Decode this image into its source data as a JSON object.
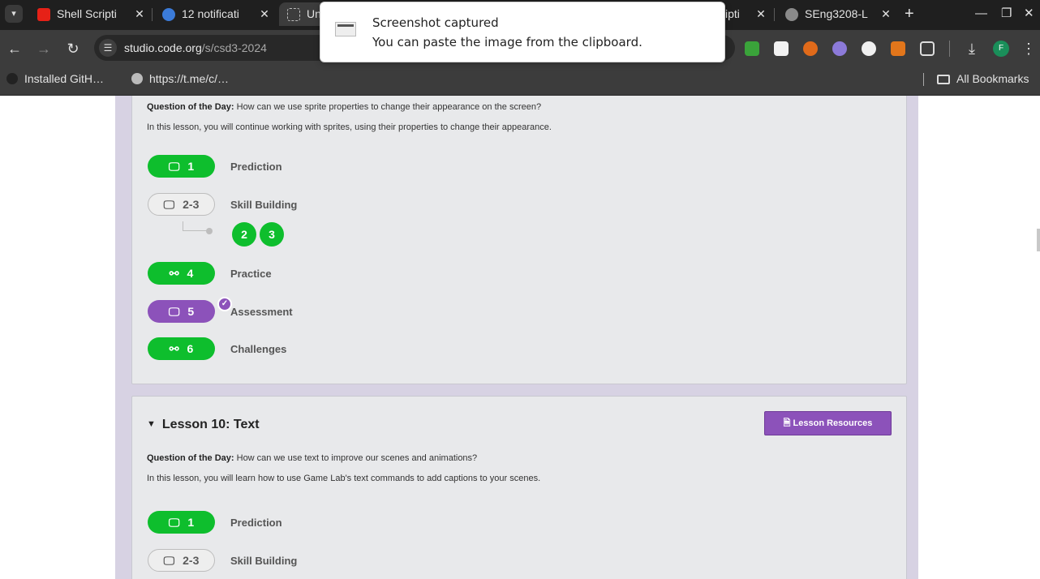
{
  "browser": {
    "tabs": [
      {
        "title": "Shell Scripti",
        "favicon_color": "#e62117"
      },
      {
        "title": "12 notificati",
        "favicon_color": "#3b7bd9"
      },
      {
        "title": "Un",
        "favicon_color": "#bbbbbb"
      },
      {
        "title": "ipti",
        "favicon_color": "#bbbbbb"
      },
      {
        "title": "SEng3208-L",
        "favicon_color": "#8a8a8a"
      }
    ],
    "new_tab_label": "+",
    "address": {
      "domain": "studio.code.org",
      "path": "/s/csd3-2024"
    },
    "profile_initial": "F",
    "bookmarks": [
      {
        "label": "Installed GitH…"
      },
      {
        "label": "https://t.me/c/…"
      }
    ],
    "all_bookmarks_label": "All Bookmarks"
  },
  "notification": {
    "title": "Screenshot captured",
    "body": "You can paste the image from the clipboard."
  },
  "lesson9": {
    "qotd_label": "Question of the Day:",
    "qotd_text": "How can we use sprite properties to change their appearance on the screen?",
    "description": "In this lesson, you will continue working with sprites, using their properties to change their appearance.",
    "levels": [
      {
        "number": "1",
        "label": "Prediction",
        "icon": "monitor-icon",
        "style": "green"
      },
      {
        "number": "2-3",
        "label": "Skill Building",
        "icon": "monitor-icon",
        "style": "outline"
      },
      {
        "number": "4",
        "label": "Practice",
        "icon": "network-icon",
        "style": "green"
      },
      {
        "number": "5",
        "label": "Assessment",
        "icon": "monitor-icon",
        "style": "purple",
        "checked": true
      },
      {
        "number": "6",
        "label": "Challenges",
        "icon": "network-icon",
        "style": "green"
      }
    ],
    "sublevels": [
      "2",
      "3"
    ]
  },
  "lesson10": {
    "title": "Lesson 10: Text",
    "resources_label": "Lesson Resources",
    "qotd_label": "Question of the Day:",
    "qotd_text": "How can we use text to improve our scenes and animations?",
    "description": "In this lesson, you will learn how to use Game Lab's text commands to add captions to your scenes.",
    "levels": [
      {
        "number": "1",
        "label": "Prediction",
        "icon": "monitor-icon",
        "style": "green"
      },
      {
        "number": "2-3",
        "label": "Skill Building",
        "icon": "monitor-icon",
        "style": "outline"
      }
    ]
  },
  "colors": {
    "green": "#0ebe2d",
    "purple": "#8c52ba",
    "card_bg": "#e8e9eb",
    "column_bg": "#d7d2e3"
  }
}
